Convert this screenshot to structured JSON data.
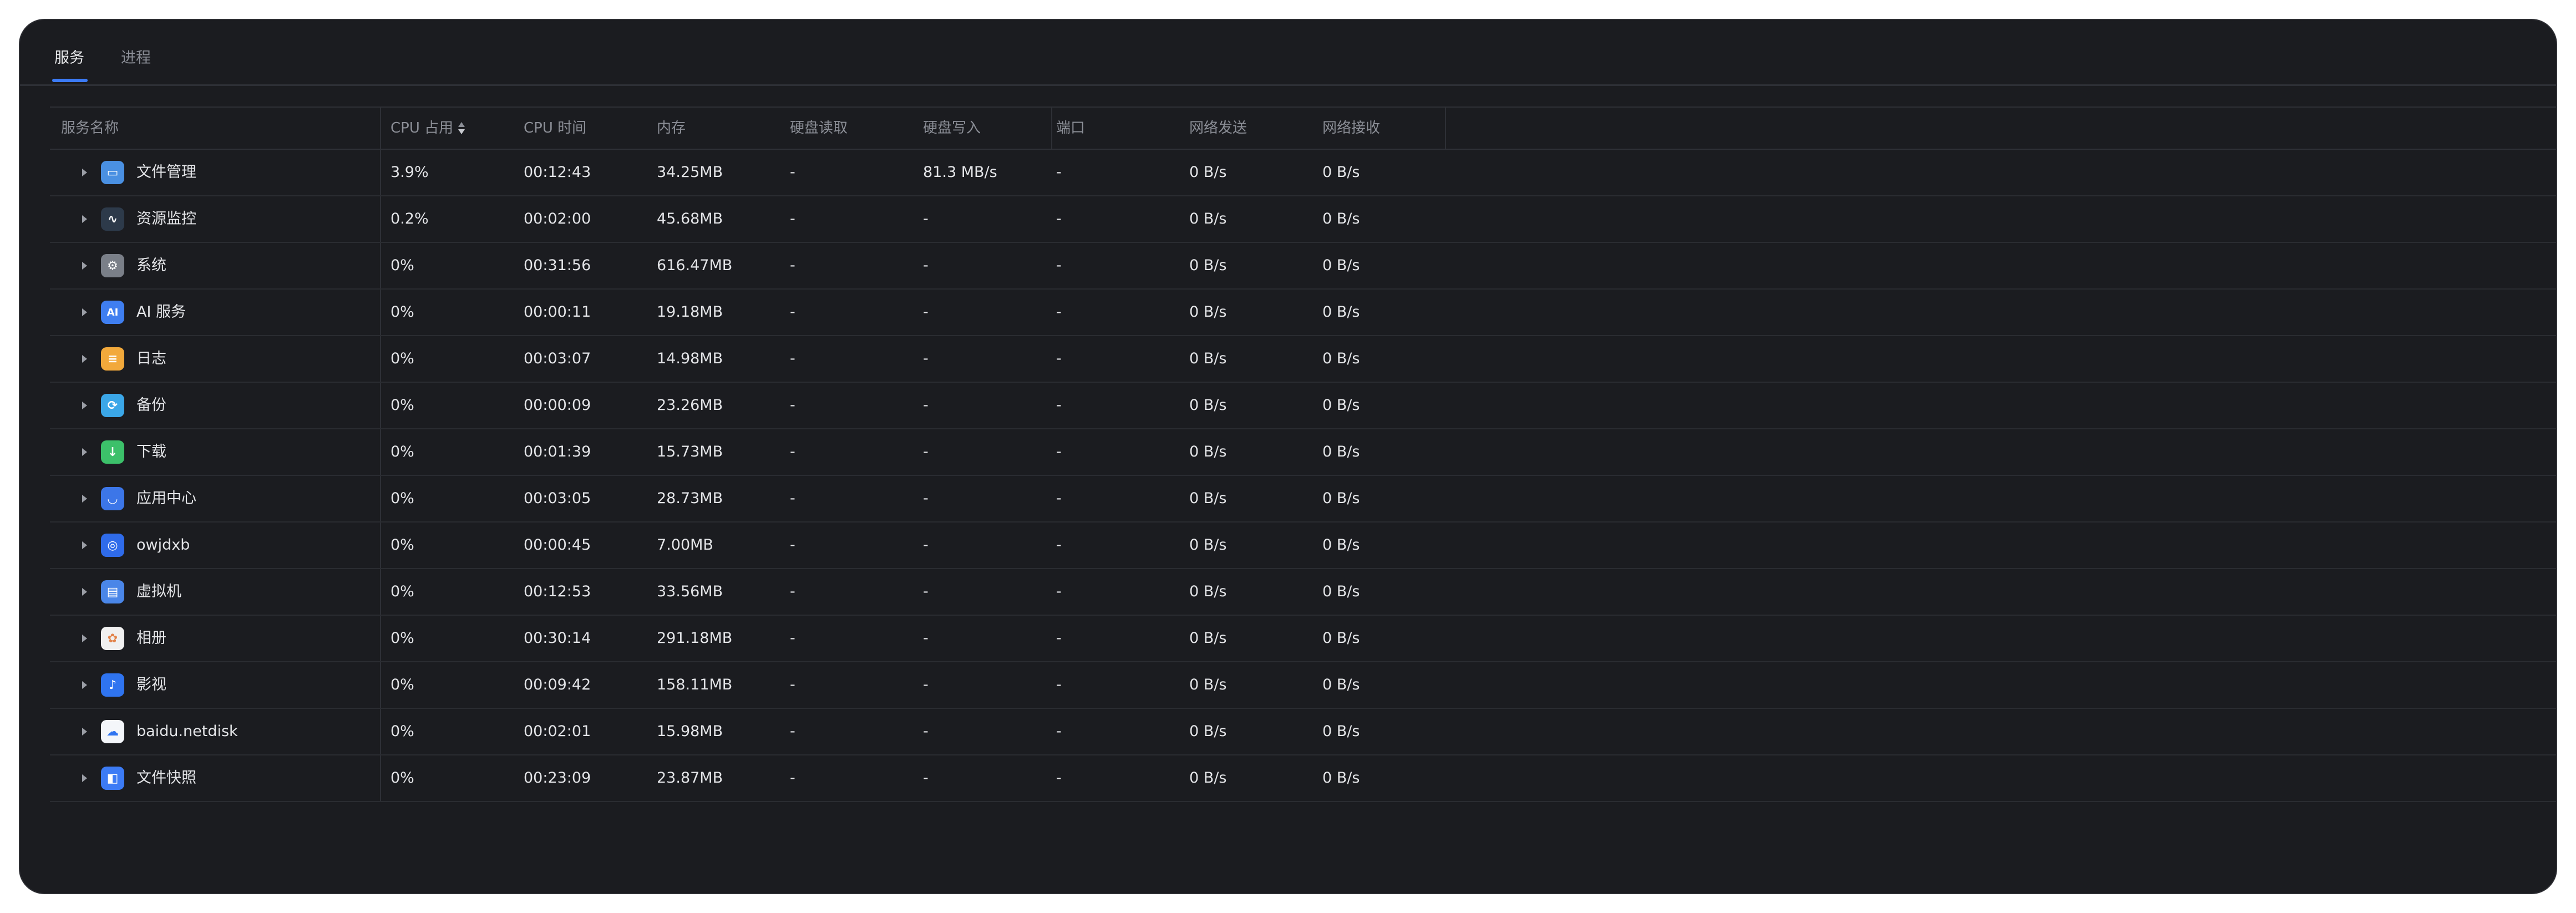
{
  "tabs": [
    {
      "label": "服务",
      "active": true
    },
    {
      "label": "进程",
      "active": false
    }
  ],
  "columns": [
    "服务名称",
    "CPU 占用",
    "CPU 时间",
    "内存",
    "硬盘读取",
    "硬盘写入",
    "端口",
    "网络发送",
    "网络接收"
  ],
  "rows": [
    {
      "name": "文件管理",
      "icon": "folder-icon",
      "icon_color": "#4a90e2",
      "cpu": "3.9%",
      "cpu_time": "00:12:43",
      "memory": "34.25MB",
      "disk_read": "-",
      "disk_write": "81.3 MB/s",
      "port": "-",
      "net_send": "0 B/s",
      "net_recv": "0 B/s"
    },
    {
      "name": "资源监控",
      "icon": "activity-monitor-icon",
      "icon_color": "#2d3a4a",
      "cpu": "0.2%",
      "cpu_time": "00:02:00",
      "memory": "45.68MB",
      "disk_read": "-",
      "disk_write": "-",
      "port": "-",
      "net_send": "0 B/s",
      "net_recv": "0 B/s"
    },
    {
      "name": "系统",
      "icon": "gear-icon",
      "icon_color": "#7a7f88",
      "cpu": "0%",
      "cpu_time": "00:31:56",
      "memory": "616.47MB",
      "disk_read": "-",
      "disk_write": "-",
      "port": "-",
      "net_send": "0 B/s",
      "net_recv": "0 B/s"
    },
    {
      "name": "AI 服务",
      "icon": "ai-icon",
      "icon_color": "#3f7ef0",
      "cpu": "0%",
      "cpu_time": "00:00:11",
      "memory": "19.18MB",
      "disk_read": "-",
      "disk_write": "-",
      "port": "-",
      "net_send": "0 B/s",
      "net_recv": "0 B/s"
    },
    {
      "name": "日志",
      "icon": "log-icon",
      "icon_color": "#f2a93b",
      "cpu": "0%",
      "cpu_time": "00:03:07",
      "memory": "14.98MB",
      "disk_read": "-",
      "disk_write": "-",
      "port": "-",
      "net_send": "0 B/s",
      "net_recv": "0 B/s"
    },
    {
      "name": "备份",
      "icon": "backup-icon",
      "icon_color": "#3ba7e8",
      "cpu": "0%",
      "cpu_time": "00:00:09",
      "memory": "23.26MB",
      "disk_read": "-",
      "disk_write": "-",
      "port": "-",
      "net_send": "0 B/s",
      "net_recv": "0 B/s"
    },
    {
      "name": "下载",
      "icon": "download-icon",
      "icon_color": "#3cc06a",
      "cpu": "0%",
      "cpu_time": "00:01:39",
      "memory": "15.73MB",
      "disk_read": "-",
      "disk_write": "-",
      "port": "-",
      "net_send": "0 B/s",
      "net_recv": "0 B/s"
    },
    {
      "name": "应用中心",
      "icon": "app-center-icon",
      "icon_color": "#3c76e8",
      "cpu": "0%",
      "cpu_time": "00:03:05",
      "memory": "28.73MB",
      "disk_read": "-",
      "disk_write": "-",
      "port": "-",
      "net_send": "0 B/s",
      "net_recv": "0 B/s"
    },
    {
      "name": "owjdxb",
      "icon": "owjdxb-icon",
      "icon_color": "#2f6bea",
      "cpu": "0%",
      "cpu_time": "00:00:45",
      "memory": "7.00MB",
      "disk_read": "-",
      "disk_write": "-",
      "port": "-",
      "net_send": "0 B/s",
      "net_recv": "0 B/s"
    },
    {
      "name": "虚拟机",
      "icon": "virtual-machine-icon",
      "icon_color": "#4a86e8",
      "cpu": "0%",
      "cpu_time": "00:12:53",
      "memory": "33.56MB",
      "disk_read": "-",
      "disk_write": "-",
      "port": "-",
      "net_send": "0 B/s",
      "net_recv": "0 B/s"
    },
    {
      "name": "相册",
      "icon": "photos-icon",
      "icon_color": "#f0f0f0",
      "cpu": "0%",
      "cpu_time": "00:30:14",
      "memory": "291.18MB",
      "disk_read": "-",
      "disk_write": "-",
      "port": "-",
      "net_send": "0 B/s",
      "net_recv": "0 B/s"
    },
    {
      "name": "影视",
      "icon": "video-icon",
      "icon_color": "#2f74f0",
      "cpu": "0%",
      "cpu_time": "00:09:42",
      "memory": "158.11MB",
      "disk_read": "-",
      "disk_write": "-",
      "port": "-",
      "net_send": "0 B/s",
      "net_recv": "0 B/s"
    },
    {
      "name": "baidu.netdisk",
      "icon": "cloud-disk-icon",
      "icon_color": "#f4f6fa",
      "cpu": "0%",
      "cpu_time": "00:02:01",
      "memory": "15.98MB",
      "disk_read": "-",
      "disk_write": "-",
      "port": "-",
      "net_send": "0 B/s",
      "net_recv": "0 B/s"
    },
    {
      "name": "文件快照",
      "icon": "snapshot-icon",
      "icon_color": "#3c7bf5",
      "cpu": "0%",
      "cpu_time": "00:23:09",
      "memory": "23.87MB",
      "disk_read": "-",
      "disk_write": "-",
      "port": "-",
      "net_send": "0 B/s",
      "net_recv": "0 B/s"
    }
  ],
  "colors": {
    "background": "#1b1c20",
    "accent": "#3c7bf5",
    "text": "#e3e4e7",
    "muted": "#8b8e96"
  }
}
